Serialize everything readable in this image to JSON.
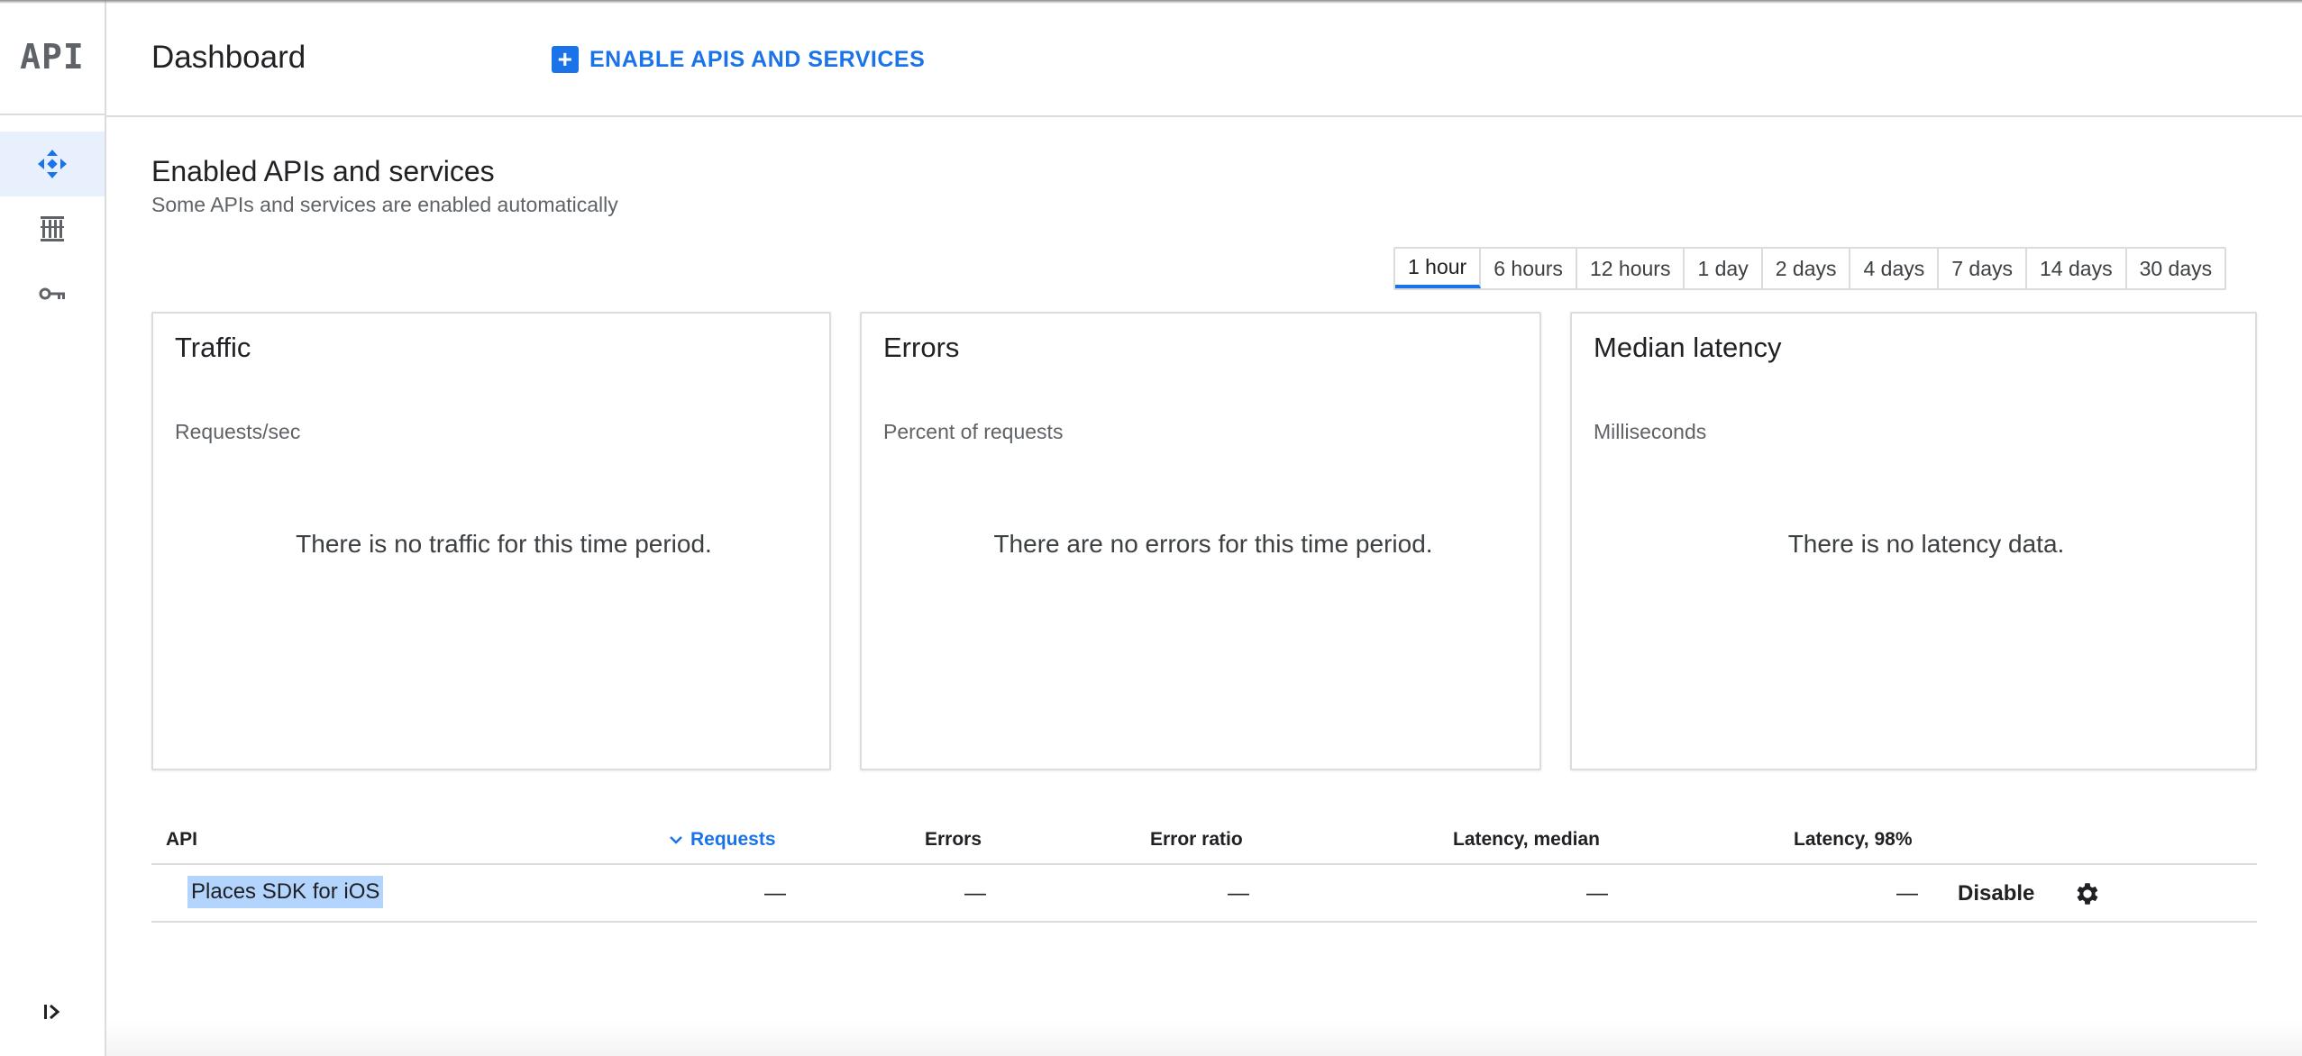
{
  "rail": {
    "logo": "API",
    "items": [
      {
        "name": "dashboard",
        "icon": "dashboard-icon",
        "active": true
      },
      {
        "name": "library",
        "icon": "library-icon",
        "active": false
      },
      {
        "name": "credentials",
        "icon": "key-icon",
        "active": false
      }
    ],
    "expand_icon": "expand-sidebar-icon"
  },
  "header": {
    "title": "Dashboard",
    "enable_button": "ENABLE APIS AND SERVICES"
  },
  "section": {
    "title": "Enabled APIs and services",
    "subtitle": "Some APIs and services are enabled automatically"
  },
  "timerange": {
    "options": [
      "1 hour",
      "6 hours",
      "12 hours",
      "1 day",
      "2 days",
      "4 days",
      "7 days",
      "14 days",
      "30 days"
    ],
    "selected": "1 hour"
  },
  "cards": [
    {
      "title": "Traffic",
      "subtitle": "Requests/sec",
      "empty": "There is no traffic for this time period."
    },
    {
      "title": "Errors",
      "subtitle": "Percent of requests",
      "empty": "There are no errors for this time period."
    },
    {
      "title": "Median latency",
      "subtitle": "Milliseconds",
      "empty": "There is no latency data."
    }
  ],
  "table": {
    "headers": {
      "api": "API",
      "requests": "Requests",
      "errors": "Errors",
      "error_ratio": "Error ratio",
      "latency_median": "Latency, median",
      "latency_98": "Latency, 98%"
    },
    "sort_icon": "chevron-down-icon",
    "rows": [
      {
        "api": "Places SDK for iOS",
        "requests": "—",
        "errors": "—",
        "error_ratio": "—",
        "latency_median": "—",
        "latency_98": "—",
        "action": "Disable",
        "settings_icon": "gear-icon"
      }
    ]
  },
  "colors": {
    "accent": "#1a73e8",
    "active_rail_bg": "#e8f0fe",
    "selection": "#b3d4fc",
    "border": "#dadce0"
  }
}
